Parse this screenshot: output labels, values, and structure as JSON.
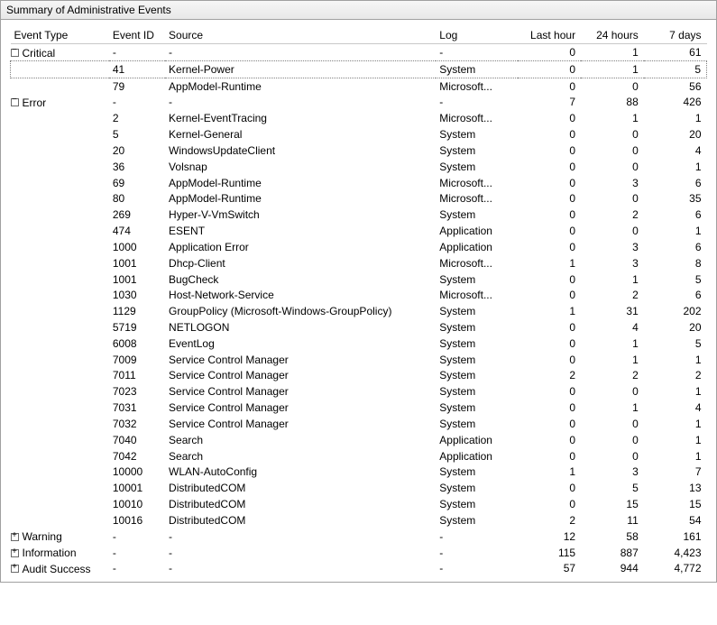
{
  "panel": {
    "title": "Summary of Administrative Events"
  },
  "columns": {
    "type": "Event Type",
    "id": "Event ID",
    "source": "Source",
    "log": "Log",
    "last_hour": "Last hour",
    "h24": "24 hours",
    "d7": "7 days"
  },
  "rows": [
    {
      "kind": "group",
      "toggle": "open",
      "type": "Critical",
      "id": "-",
      "source": "-",
      "log": "-",
      "last_hour": "0",
      "h24": "1",
      "d7": "61"
    },
    {
      "kind": "child",
      "focused": true,
      "type": "",
      "id": "41",
      "source": "Kernel-Power",
      "log": "System",
      "last_hour": "0",
      "h24": "1",
      "d7": "5"
    },
    {
      "kind": "child",
      "type": "",
      "id": "79",
      "source": "AppModel-Runtime",
      "log": "Microsoft...",
      "last_hour": "0",
      "h24": "0",
      "d7": "56"
    },
    {
      "kind": "group",
      "toggle": "open",
      "type": "Error",
      "id": "-",
      "source": "-",
      "log": "-",
      "last_hour": "7",
      "h24": "88",
      "d7": "426"
    },
    {
      "kind": "child",
      "type": "",
      "id": "2",
      "source": "Kernel-EventTracing",
      "log": "Microsoft...",
      "last_hour": "0",
      "h24": "1",
      "d7": "1"
    },
    {
      "kind": "child",
      "type": "",
      "id": "5",
      "source": "Kernel-General",
      "log": "System",
      "last_hour": "0",
      "h24": "0",
      "d7": "20"
    },
    {
      "kind": "child",
      "type": "",
      "id": "20",
      "source": "WindowsUpdateClient",
      "log": "System",
      "last_hour": "0",
      "h24": "0",
      "d7": "4"
    },
    {
      "kind": "child",
      "type": "",
      "id": "36",
      "source": "Volsnap",
      "log": "System",
      "last_hour": "0",
      "h24": "0",
      "d7": "1"
    },
    {
      "kind": "child",
      "type": "",
      "id": "69",
      "source": "AppModel-Runtime",
      "log": "Microsoft...",
      "last_hour": "0",
      "h24": "3",
      "d7": "6"
    },
    {
      "kind": "child",
      "type": "",
      "id": "80",
      "source": "AppModel-Runtime",
      "log": "Microsoft...",
      "last_hour": "0",
      "h24": "0",
      "d7": "35"
    },
    {
      "kind": "child",
      "type": "",
      "id": "269",
      "source": "Hyper-V-VmSwitch",
      "log": "System",
      "last_hour": "0",
      "h24": "2",
      "d7": "6"
    },
    {
      "kind": "child",
      "type": "",
      "id": "474",
      "source": "ESENT",
      "log": "Application",
      "last_hour": "0",
      "h24": "0",
      "d7": "1"
    },
    {
      "kind": "child",
      "type": "",
      "id": "1000",
      "source": "Application Error",
      "log": "Application",
      "last_hour": "0",
      "h24": "3",
      "d7": "6"
    },
    {
      "kind": "child",
      "type": "",
      "id": "1001",
      "source": "Dhcp-Client",
      "log": "Microsoft...",
      "last_hour": "1",
      "h24": "3",
      "d7": "8"
    },
    {
      "kind": "child",
      "type": "",
      "id": "1001",
      "source": "BugCheck",
      "log": "System",
      "last_hour": "0",
      "h24": "1",
      "d7": "5"
    },
    {
      "kind": "child",
      "type": "",
      "id": "1030",
      "source": "Host-Network-Service",
      "log": "Microsoft...",
      "last_hour": "0",
      "h24": "2",
      "d7": "6"
    },
    {
      "kind": "child",
      "type": "",
      "id": "1129",
      "source": "GroupPolicy (Microsoft-Windows-GroupPolicy)",
      "log": "System",
      "last_hour": "1",
      "h24": "31",
      "d7": "202"
    },
    {
      "kind": "child",
      "type": "",
      "id": "5719",
      "source": "NETLOGON",
      "log": "System",
      "last_hour": "0",
      "h24": "4",
      "d7": "20"
    },
    {
      "kind": "child",
      "type": "",
      "id": "6008",
      "source": "EventLog",
      "log": "System",
      "last_hour": "0",
      "h24": "1",
      "d7": "5"
    },
    {
      "kind": "child",
      "type": "",
      "id": "7009",
      "source": "Service Control Manager",
      "log": "System",
      "last_hour": "0",
      "h24": "1",
      "d7": "1"
    },
    {
      "kind": "child",
      "type": "",
      "id": "7011",
      "source": "Service Control Manager",
      "log": "System",
      "last_hour": "2",
      "h24": "2",
      "d7": "2"
    },
    {
      "kind": "child",
      "type": "",
      "id": "7023",
      "source": "Service Control Manager",
      "log": "System",
      "last_hour": "0",
      "h24": "0",
      "d7": "1"
    },
    {
      "kind": "child",
      "type": "",
      "id": "7031",
      "source": "Service Control Manager",
      "log": "System",
      "last_hour": "0",
      "h24": "1",
      "d7": "4"
    },
    {
      "kind": "child",
      "type": "",
      "id": "7032",
      "source": "Service Control Manager",
      "log": "System",
      "last_hour": "0",
      "h24": "0",
      "d7": "1"
    },
    {
      "kind": "child",
      "type": "",
      "id": "7040",
      "source": "Search",
      "log": "Application",
      "last_hour": "0",
      "h24": "0",
      "d7": "1"
    },
    {
      "kind": "child",
      "type": "",
      "id": "7042",
      "source": "Search",
      "log": "Application",
      "last_hour": "0",
      "h24": "0",
      "d7": "1"
    },
    {
      "kind": "child",
      "type": "",
      "id": "10000",
      "source": "WLAN-AutoConfig",
      "log": "System",
      "last_hour": "1",
      "h24": "3",
      "d7": "7"
    },
    {
      "kind": "child",
      "type": "",
      "id": "10001",
      "source": "DistributedCOM",
      "log": "System",
      "last_hour": "0",
      "h24": "5",
      "d7": "13"
    },
    {
      "kind": "child",
      "type": "",
      "id": "10010",
      "source": "DistributedCOM",
      "log": "System",
      "last_hour": "0",
      "h24": "15",
      "d7": "15"
    },
    {
      "kind": "child",
      "type": "",
      "id": "10016",
      "source": "DistributedCOM",
      "log": "System",
      "last_hour": "2",
      "h24": "11",
      "d7": "54"
    },
    {
      "kind": "group",
      "toggle": "closed",
      "type": "Warning",
      "id": "-",
      "source": "-",
      "log": "-",
      "last_hour": "12",
      "h24": "58",
      "d7": "161"
    },
    {
      "kind": "group",
      "toggle": "closed",
      "type": "Information",
      "id": "-",
      "source": "-",
      "log": "-",
      "last_hour": "115",
      "h24": "887",
      "d7": "4,423"
    },
    {
      "kind": "group",
      "toggle": "closed",
      "type": "Audit Success",
      "id": "-",
      "source": "-",
      "log": "-",
      "last_hour": "57",
      "h24": "944",
      "d7": "4,772"
    }
  ]
}
